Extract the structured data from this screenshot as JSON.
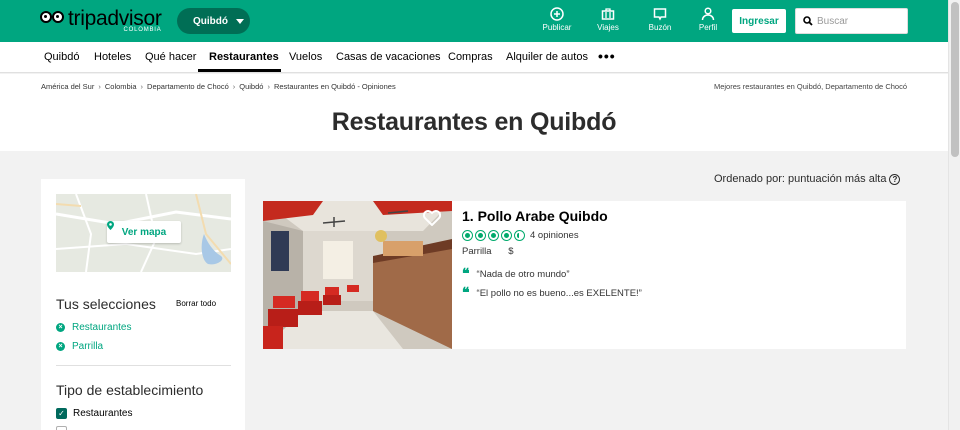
{
  "brand": {
    "name": "tripadvisor",
    "country": "COLOMBIA",
    "accent": "#00a680"
  },
  "city_selector": {
    "label": "Quibdó"
  },
  "header_actions": [
    {
      "label": "Publicar",
      "icon": "plus-circle-icon"
    },
    {
      "label": "Viajes",
      "icon": "suitcase-icon"
    },
    {
      "label": "Buzón",
      "icon": "inbox-icon"
    },
    {
      "label": "Perfil",
      "icon": "person-icon"
    }
  ],
  "login_button": "Ingresar",
  "search": {
    "placeholder": "Buscar",
    "value": ""
  },
  "nav": {
    "items": [
      "Quibdó",
      "Hoteles",
      "Qué hacer",
      "Restaurantes",
      "Vuelos",
      "Casas de vacaciones",
      "Compras",
      "Alquiler de autos"
    ],
    "active": "Restaurantes",
    "more": "•••"
  },
  "breadcrumb": [
    "América del Sur",
    "Colombia",
    "Departamento de Chocó",
    "Quibdó",
    "Restaurantes en Quibdó - Opiniones"
  ],
  "best_link": "Mejores restaurantes en Quibdó, Departamento de Chocó",
  "page_title": "Restaurantes en Quibdó",
  "sidebar": {
    "map_button": "Ver mapa",
    "selections_heading": "Tus selecciones",
    "clear_all": "Borrar todo",
    "selections": [
      "Restaurantes",
      "Parrilla"
    ],
    "establishment_heading": "Tipo de establecimiento",
    "establishment_options": [
      {
        "label": "Restaurantes",
        "checked": true
      }
    ]
  },
  "sort_label": "Ordenado por: puntuación más alta",
  "results": [
    {
      "title": "1. Pollo Arabe Quibdo",
      "rating": 4.5,
      "reviews": "4 opiniones",
      "cuisine": "Parrilla",
      "price": "$",
      "quotes": [
        "“Nada de otro mundo”",
        "“El pollo no es bueno...es EXELENTE!”"
      ]
    }
  ]
}
